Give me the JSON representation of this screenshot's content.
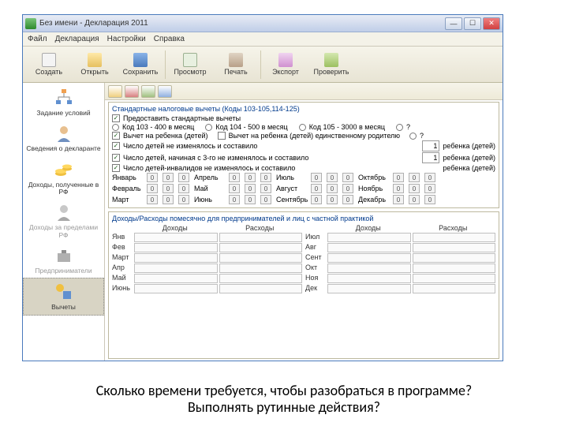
{
  "window": {
    "title": "Без имени - Декларация 2011"
  },
  "menu": [
    "Файл",
    "Декларация",
    "Настройки",
    "Справка"
  ],
  "toolbar": [
    {
      "label": "Создать",
      "color": "#f0f0f0"
    },
    {
      "label": "Открыть",
      "color": "#ffe9a8"
    },
    {
      "label": "Сохранить",
      "color": "#b8d8ff"
    },
    {
      "label": "Просмотр",
      "color": "#cfe8cf"
    },
    {
      "label": "Печать",
      "color": "#e0d0c0"
    },
    {
      "label": "Экспорт",
      "color": "#f0d0f0"
    },
    {
      "label": "Проверить",
      "color": "#d0e0b0"
    }
  ],
  "sidebar": [
    {
      "label": "Задание условий"
    },
    {
      "label": "Сведения о декларанте"
    },
    {
      "label": "Доходы, полученные в РФ"
    },
    {
      "label": "Доходы за пределами РФ"
    },
    {
      "label": "Предприниматели"
    },
    {
      "label": "Вычеты",
      "selected": true
    }
  ],
  "panel": {
    "group_title": "Стандартные налоговые вычеты (Коды 103-105,114-125)",
    "cb_grant": "Предоставить стандартные вычеты",
    "r_code103": "Код 103 - 400 в месяц",
    "r_code104": "Код 104 - 500 в месяц",
    "r_code105": "Код 105 - 3000 в месяц",
    "r_q": "?",
    "cb_child1": "Вычет на ребенка (детей)",
    "cb_child2": "Вычет на ребенка (детей) единственному родителю",
    "r_q2": "?",
    "line_num1": "Число детей не изменялось и составило",
    "line_num1_suffix": "ребенка (детей)",
    "line_num2": "Число детей, начиная с 3-го не изменялось и составило",
    "line_num2_suffix": "ребенка (детей)",
    "line_num3": "Число детей-инвалидов не изменялось и составило",
    "line_num3_suffix": "ребенка (детей)",
    "spn1": "1",
    "spn2": "1",
    "months": [
      "Январь",
      "Февраль",
      "Март",
      "Апрель",
      "Май",
      "Июнь",
      "Июль",
      "Август",
      "Сентябрь",
      "Октябрь",
      "Ноябрь",
      "Декабрь"
    ],
    "zero": "0",
    "table_title": "Доходы/Расходы помесячно для предпринимателей и лиц с частной практикой",
    "col_in": "Доходы",
    "col_out": "Расходы",
    "tmonths_l": [
      "Янв",
      "Фев",
      "Март",
      "Апр",
      "Май",
      "Июнь"
    ],
    "tmonths_r": [
      "Июл",
      "Авг",
      "Сент",
      "Окт",
      "Ноя",
      "Дек"
    ]
  },
  "caption_l1": "Сколько времени требуется, чтобы разобраться в программе?",
  "caption_l2": "Выполнять рутинные действия?"
}
